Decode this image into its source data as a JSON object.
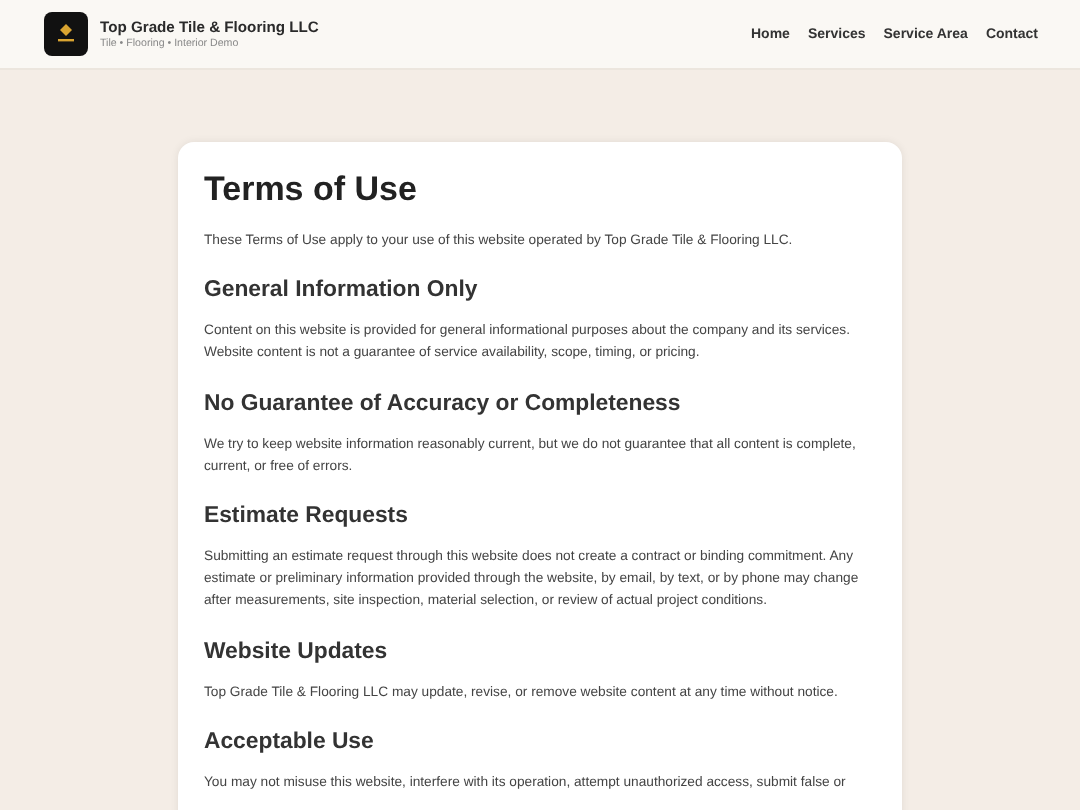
{
  "header": {
    "company": "Top Grade Tile & Flooring LLC",
    "tagline": "Tile • Flooring • Interior Demo",
    "nav": [
      {
        "label": "Home"
      },
      {
        "label": "Services"
      },
      {
        "label": "Service Area"
      },
      {
        "label": "Contact"
      }
    ]
  },
  "page": {
    "title": "Terms of Use",
    "intro": "These Terms of Use apply to your use of this website operated by Top Grade Tile & Flooring LLC.",
    "sections": [
      {
        "heading": "General Information Only",
        "body": "Content on this website is provided for general informational purposes about the company and its services. Website content is not a guarantee of service availability, scope, timing, or pricing."
      },
      {
        "heading": "No Guarantee of Accuracy or Completeness",
        "body": "We try to keep website information reasonably current, but we do not guarantee that all content is complete, current, or free of errors."
      },
      {
        "heading": "Estimate Requests",
        "body": "Submitting an estimate request through this website does not create a contract or binding commitment. Any estimate or preliminary information provided through the website, by email, by text, or by phone may change after measurements, site inspection, material selection, or review of actual project conditions."
      },
      {
        "heading": "Website Updates",
        "body": "Top Grade Tile & Flooring LLC may update, revise, or remove website content at any time without notice."
      },
      {
        "heading": "Acceptable Use",
        "body": "You may not misuse this website, interfere with its operation, attempt unauthorized access, submit false or"
      }
    ]
  }
}
